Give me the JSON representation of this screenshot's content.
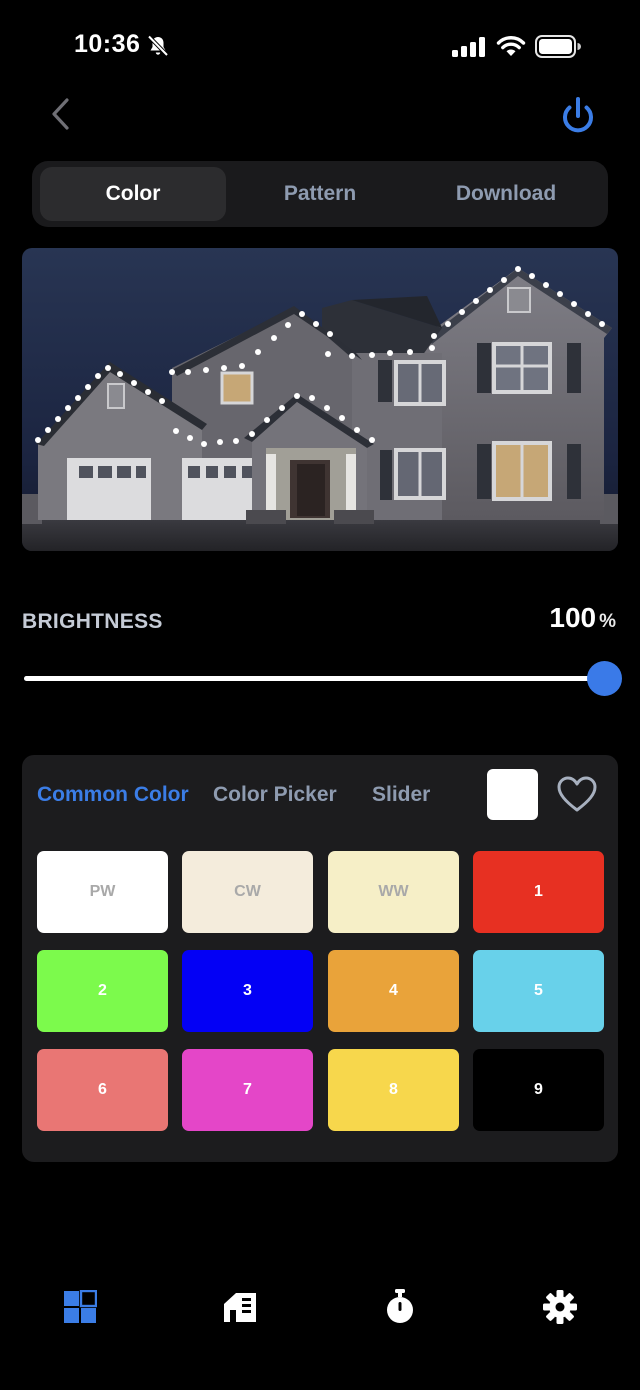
{
  "status_bar": {
    "time": "10:36"
  },
  "tabs": [
    {
      "label": "Color",
      "active": true
    },
    {
      "label": "Pattern",
      "active": false
    },
    {
      "label": "Download",
      "active": false
    }
  ],
  "brightness": {
    "label": "BRIGHTNESS",
    "value": "100",
    "unit": "%",
    "fraction": 1.0
  },
  "color_panel": {
    "modes": [
      {
        "label": "Common Color",
        "active": true
      },
      {
        "label": "Color Picker",
        "active": false
      },
      {
        "label": "Slider",
        "active": false
      }
    ],
    "current_color": "#ffffff",
    "swatches": [
      {
        "label": "PW",
        "color": "#ffffff",
        "text_color": "#a9a9a9"
      },
      {
        "label": "CW",
        "color": "#f4ecdc",
        "text_color": "#a9a9a9"
      },
      {
        "label": "WW",
        "color": "#f6efc7",
        "text_color": "#a9a9a9"
      },
      {
        "label": "1",
        "color": "#e73022",
        "text_color": "#ffffff"
      },
      {
        "label": "2",
        "color": "#7cfa4c",
        "text_color": "#ffffff"
      },
      {
        "label": "3",
        "color": "#0300f5",
        "text_color": "#ffffff"
      },
      {
        "label": "4",
        "color": "#e9a33a",
        "text_color": "#ffffff"
      },
      {
        "label": "5",
        "color": "#68d1ea",
        "text_color": "#ffffff"
      },
      {
        "label": "6",
        "color": "#e97674",
        "text_color": "#ffffff"
      },
      {
        "label": "7",
        "color": "#e446c8",
        "text_color": "#ffffff"
      },
      {
        "label": "8",
        "color": "#f7d74c",
        "text_color": "#ffffff"
      },
      {
        "label": "9",
        "color": "#000000",
        "text_color": "#ffffff"
      }
    ]
  },
  "bottom_nav": [
    {
      "icon": "grid-icon",
      "active": true
    },
    {
      "icon": "house-layout-icon",
      "active": false
    },
    {
      "icon": "timer-icon",
      "active": false
    },
    {
      "icon": "gear-icon",
      "active": false
    }
  ],
  "colors": {
    "accent": "#3b7de6",
    "background": "#000000",
    "panel": "#1c1c1e"
  }
}
